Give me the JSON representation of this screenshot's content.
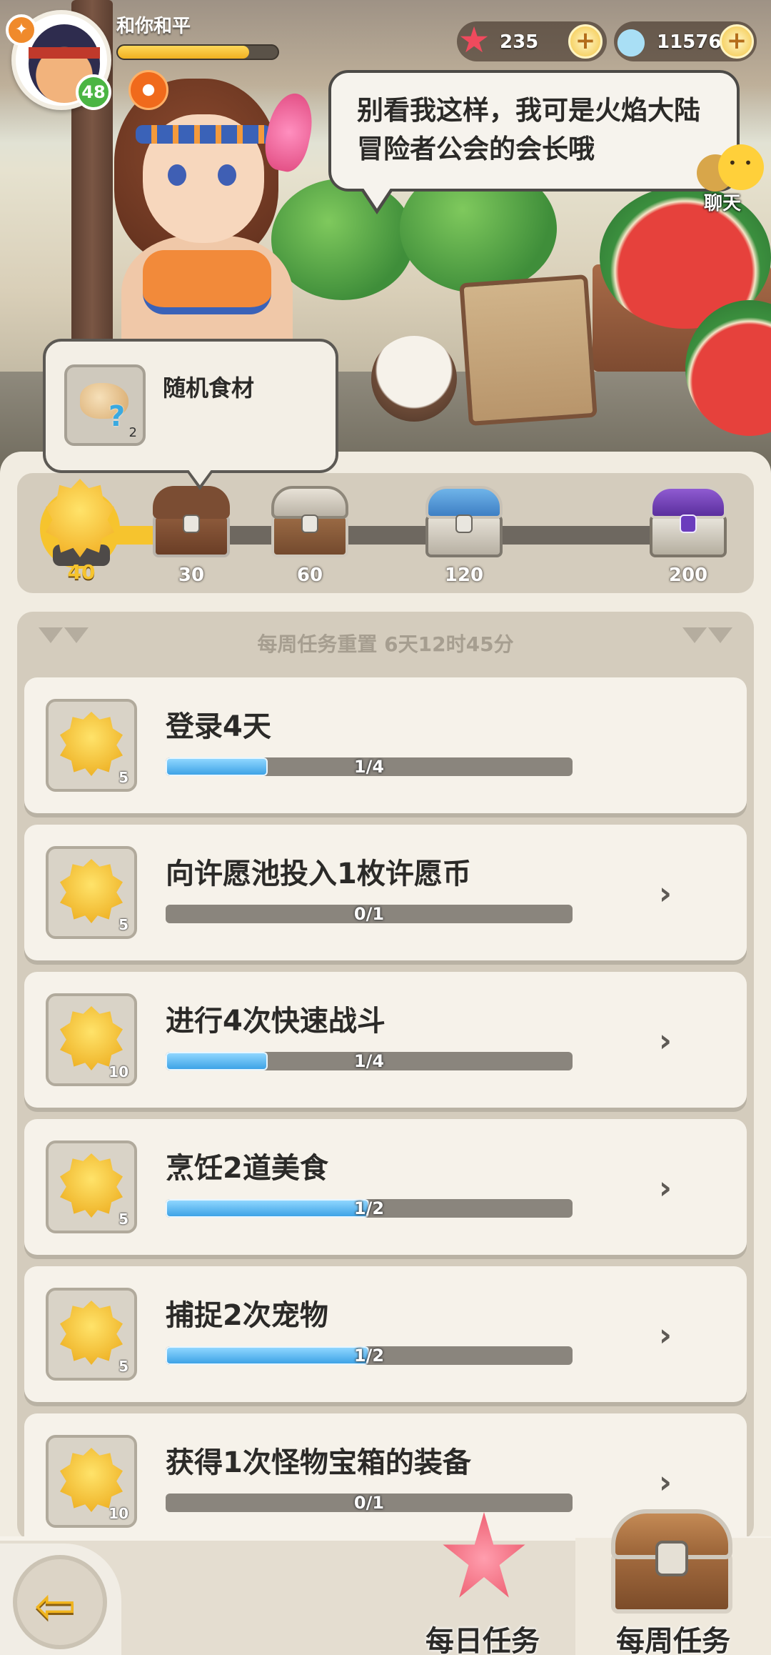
{
  "player": {
    "name": "和你和平",
    "level": "48",
    "xp_fraction": 0.82
  },
  "currencies": [
    {
      "icon": "starfish-icon",
      "value": "235"
    },
    {
      "icon": "shell-gem-icon",
      "value": "115768"
    }
  ],
  "npc": {
    "speech": "别看我这样，我可是火焰大陆冒险者公会的会长哦",
    "chat_label": "聊天"
  },
  "reward_tooltip": {
    "label": "随机食材",
    "count": "2"
  },
  "progress": {
    "current_points": "40",
    "milestones": [
      {
        "points": "30",
        "chest": "wooden-chest"
      },
      {
        "points": "60",
        "chest": "silver-chest"
      },
      {
        "points": "120",
        "chest": "blue-chest"
      },
      {
        "points": "200",
        "chest": "purple-chest"
      }
    ]
  },
  "weekly": {
    "reset_text": "每周任务重置  6天12时45分",
    "tasks": [
      {
        "title": "登录4天",
        "reward": "5",
        "progress": "1/4",
        "fraction": 0.25,
        "has_arrow": false
      },
      {
        "title": "向许愿池投入1枚许愿币",
        "reward": "5",
        "progress": "0/1",
        "fraction": 0.0,
        "has_arrow": true
      },
      {
        "title": "进行4次快速战斗",
        "reward": "10",
        "progress": "1/4",
        "fraction": 0.25,
        "has_arrow": true
      },
      {
        "title": "烹饪2道美食",
        "reward": "5",
        "progress": "1/2",
        "fraction": 0.5,
        "has_arrow": true
      },
      {
        "title": "捕捉2次宠物",
        "reward": "5",
        "progress": "1/2",
        "fraction": 0.5,
        "has_arrow": true
      },
      {
        "title": "获得1次怪物宝箱的装备",
        "reward": "10",
        "progress": "0/1",
        "fraction": 0.0,
        "has_arrow": true
      }
    ]
  },
  "nav": {
    "daily_label": "每日任务",
    "weekly_label": "每周任务",
    "active": "weekly"
  }
}
